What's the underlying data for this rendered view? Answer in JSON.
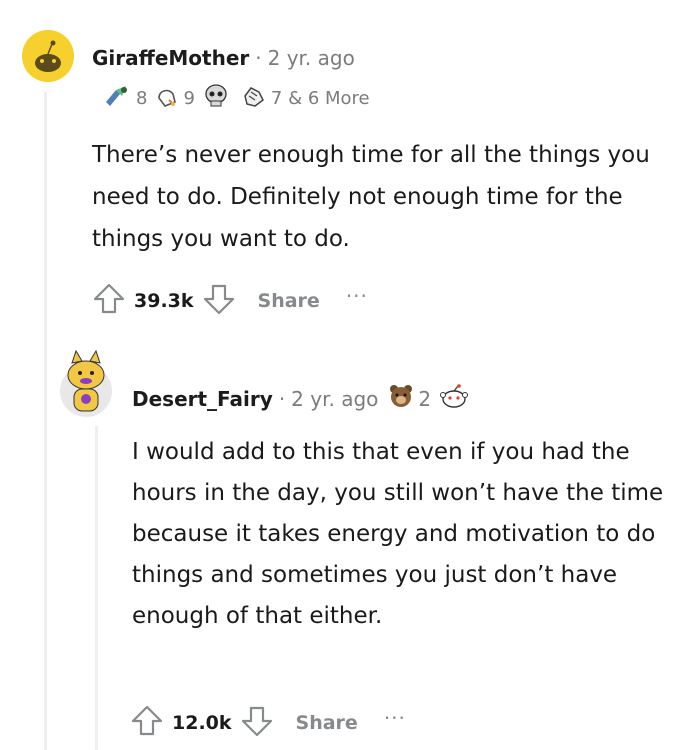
{
  "comments": [
    {
      "username": "GiraffeMother",
      "separator": "·",
      "time": "2 yr. ago",
      "awards": [
        {
          "icon": "helpful-award-icon",
          "count": "8"
        },
        {
          "icon": "wholesome-award-icon",
          "count": "9"
        },
        {
          "icon": "skull-award-icon",
          "count": ""
        },
        {
          "icon": "bravo-award-icon",
          "count": "7 & 6 More"
        }
      ],
      "text": "There’s never enough time for all the things you need to do. Definitely not enough time for the things you want to do.",
      "votes": "39.3k",
      "share_label": "Share",
      "more_label": "···"
    },
    {
      "username": "Desert_Fairy",
      "separator": "·",
      "time": "2 yr. ago",
      "awards": [
        {
          "icon": "bear-award-icon",
          "count": "2"
        },
        {
          "icon": "snoo-award-icon",
          "count": ""
        }
      ],
      "text": "I would add to this that even if you had the hours in the day, you still won’t have the time because it takes energy and motivation to do things and sometimes you just don’t have enough of that either.",
      "votes": "12.0k",
      "share_label": "Share",
      "more_label": "···"
    }
  ],
  "colors": {
    "avatar1_bg": "#f6d12e",
    "thread_line": "#edeff1",
    "muted": "#7c7c7c"
  }
}
